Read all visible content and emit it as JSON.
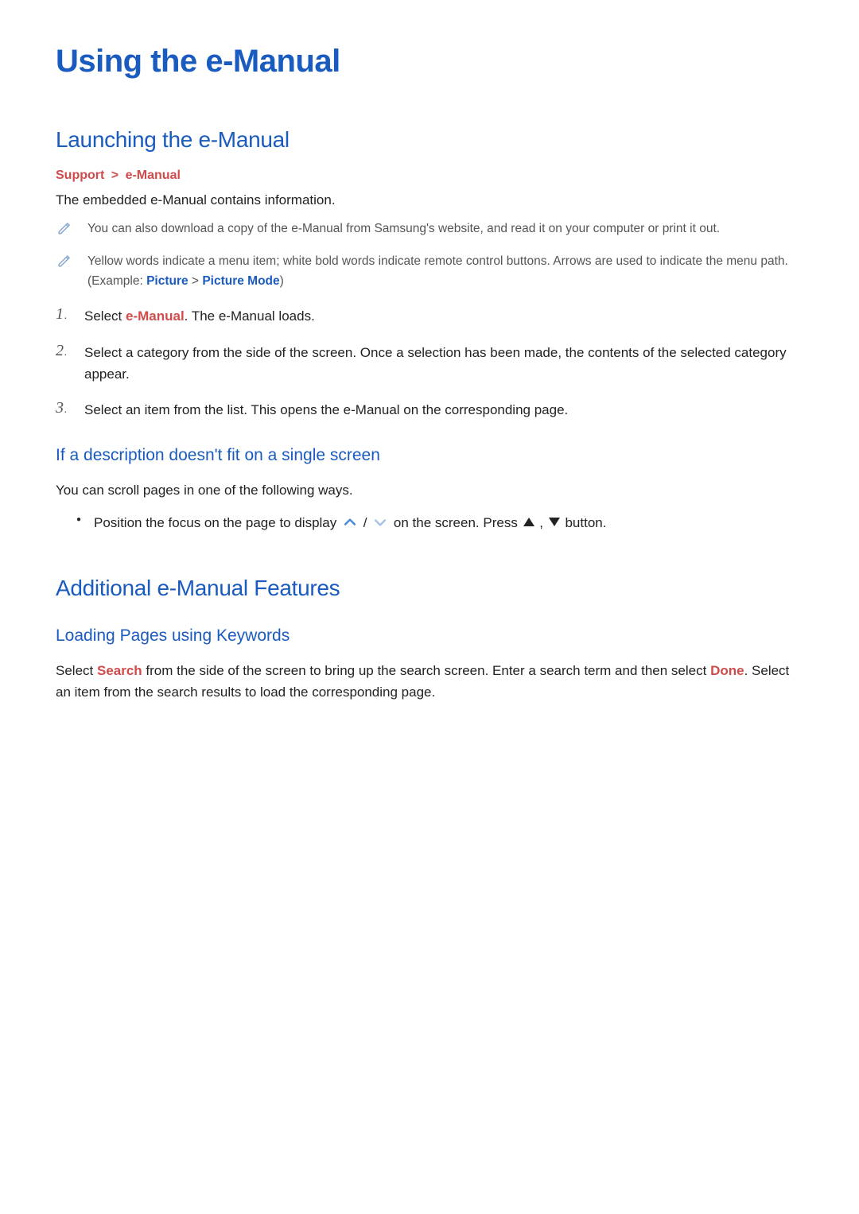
{
  "page_title": "Using the e-Manual",
  "section1": {
    "title": "Launching the e-Manual",
    "breadcrumb": {
      "a": "Support",
      "b": "e-Manual",
      "sep": ">"
    },
    "intro": "The embedded e-Manual contains information.",
    "notes": [
      {
        "text": "You can also download a copy of the e-Manual from Samsung's website, and read it on your computer or print it out."
      },
      {
        "parts": [
          {
            "t": "Yellow words indicate a menu item; white bold words indicate remote control buttons. Arrows are used to indicate the menu path. (Example: "
          },
          {
            "t": "Picture",
            "kind": "menu"
          },
          {
            "t": " > "
          },
          {
            "t": "Picture Mode",
            "kind": "menu"
          },
          {
            "t": ")"
          }
        ]
      }
    ],
    "steps": [
      {
        "num": "1",
        "parts": [
          {
            "t": "Select "
          },
          {
            "t": "e-Manual",
            "kind": "keyword"
          },
          {
            "t": ". The e-Manual loads."
          }
        ]
      },
      {
        "num": "2",
        "text": "Select a category from the side of the screen. Once a selection has been made, the contents of the selected category appear."
      },
      {
        "num": "3",
        "text": "Select an item from the list. This opens the e-Manual on the corresponding page."
      }
    ],
    "subsection": {
      "title": "If a description doesn't fit on a single screen",
      "intro": "You can scroll pages in one of the following ways.",
      "bullet": {
        "pre": "Position the focus on the page to display ",
        "mid": " / ",
        "post": " on the screen. Press ",
        "comma": ", ",
        "tail": " button."
      }
    }
  },
  "section2": {
    "title": "Additional e-Manual Features",
    "sub_title": "Loading Pages using Keywords",
    "body": {
      "parts": [
        {
          "t": "Select "
        },
        {
          "t": "Search",
          "kind": "keyword"
        },
        {
          "t": " from the side of the screen to bring up the search screen. Enter a search term and then select "
        },
        {
          "t": "Done",
          "kind": "keyword"
        },
        {
          "t": ". Select an item from the search results to load the corresponding page."
        }
      ]
    }
  }
}
